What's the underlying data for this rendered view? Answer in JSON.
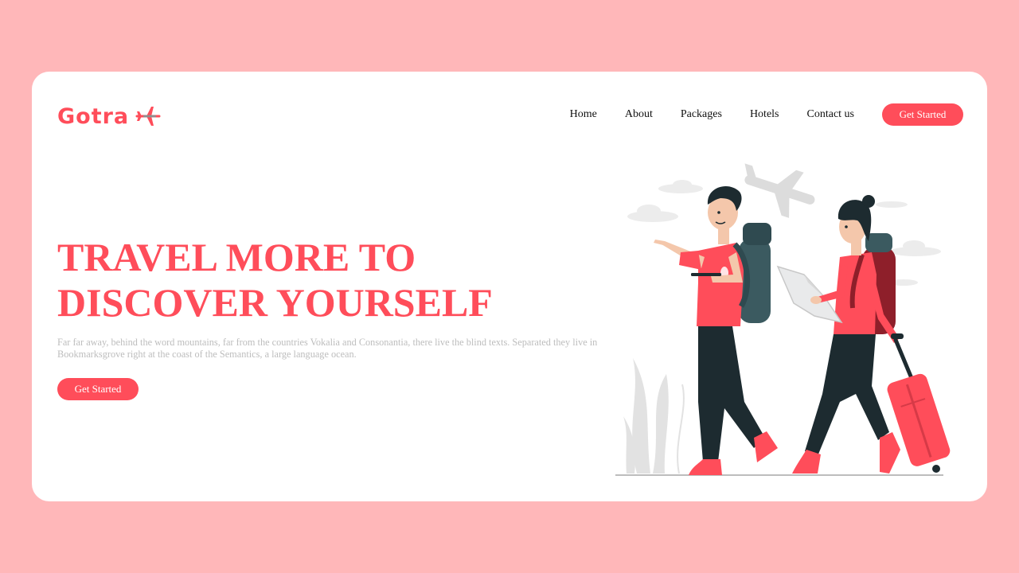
{
  "brand": {
    "name": "Gotra",
    "icon": "airplane-icon",
    "color": "#ff4d5a"
  },
  "nav": {
    "links": [
      "Home",
      "About",
      "Packages",
      "Hotels",
      "Contact us"
    ],
    "cta_label": "Get Started"
  },
  "hero": {
    "title_line1": "TRAVEL MORE TO",
    "title_line2": "DISCOVER YOURSELF",
    "description": "Far far away, behind the word mountains, far from the countries Vokalia and Consonantia, there live the blind texts. Separated they live in Bookmarksgrove right at the coast of the Semantics, a large language ocean.",
    "cta_label": "Get Started"
  },
  "colors": {
    "page_background": "#ffb7b9",
    "card_background": "#ffffff",
    "accent": "#ff4d5a",
    "muted_text": "#bdbdbd"
  }
}
